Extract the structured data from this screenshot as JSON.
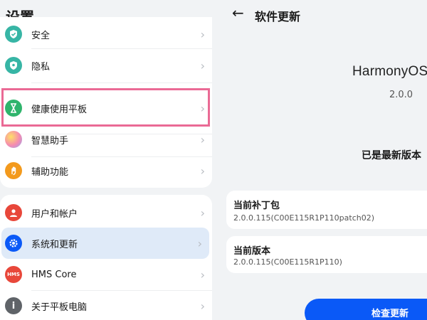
{
  "left": {
    "title": "设置",
    "group1": [
      {
        "label": "安全",
        "icon": "shield-check-icon",
        "color": "#37b5a5"
      },
      {
        "label": "隐私",
        "icon": "privacy-shield-icon",
        "color": "#37b5a5"
      },
      {
        "label": "健康使用平板",
        "icon": "hourglass-icon",
        "color": "#2fb46c"
      },
      {
        "label": "智慧助手",
        "icon": "celia-orb-icon",
        "color": "#f0a8c0"
      },
      {
        "label": "辅助功能",
        "icon": "hand-icon",
        "color": "#f39a1d"
      }
    ],
    "group2": [
      {
        "label": "用户和帐户",
        "icon": "user-icon",
        "color": "#e8473a"
      },
      {
        "label": "系统和更新",
        "icon": "gear-icon",
        "color": "#0a59f7"
      },
      {
        "label": "HMS Core",
        "icon": "hms-icon",
        "color": "#e8473a",
        "glyph": "HMS"
      },
      {
        "label": "关于平板电脑",
        "icon": "info-icon",
        "color": "#5f6368",
        "glyph": "i"
      }
    ],
    "selected_item": "系统和更新"
  },
  "right": {
    "title": "软件更新",
    "brand": "HarmonyOS",
    "version": "2.0.0",
    "status": "已是最新版本",
    "patch_label": "当前补丁包",
    "patch_value": "2.0.0.115(C00E115R1P110patch02)",
    "version_label": "当前版本",
    "version_value": "2.0.0.115(C00E115R1P110)",
    "check_button": "检查更新"
  },
  "colors": {
    "accent": "#0a59f7",
    "highlight": "#ea6a95",
    "selected_bg": "#dfeaf8"
  }
}
